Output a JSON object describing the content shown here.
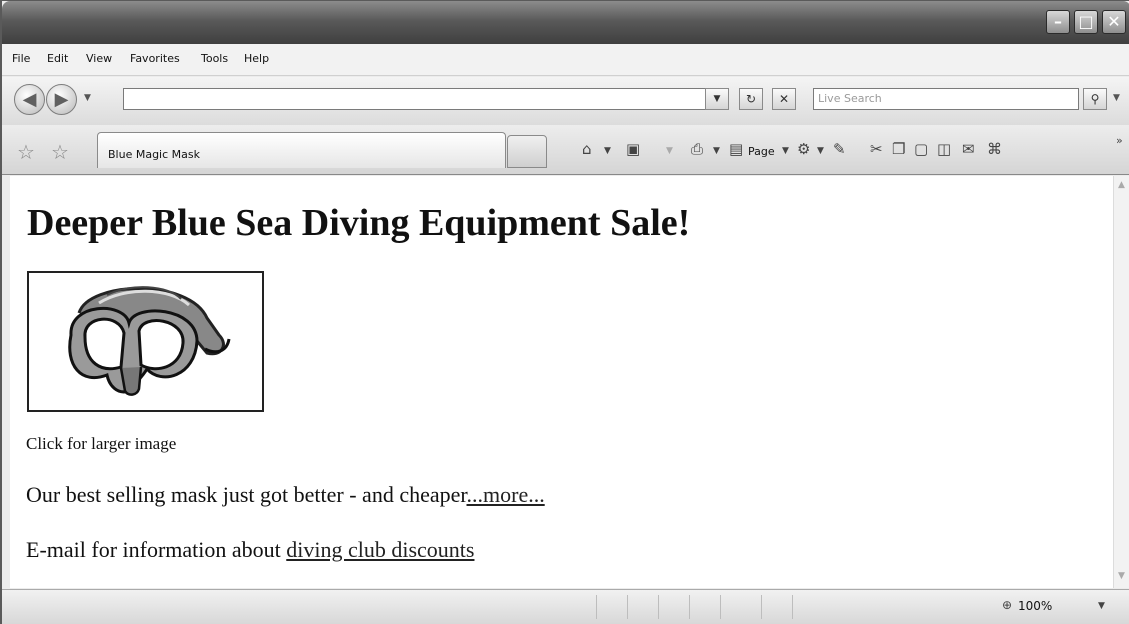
{
  "menu": [
    "File",
    "Edit",
    "View",
    "Favorites",
    "Tools",
    "Help"
  ],
  "address": {
    "value": "",
    "search_placeholder": "Live Search"
  },
  "tab": {
    "title": "Blue Magic Mask"
  },
  "toolbar": {
    "page_label": "Page"
  },
  "page": {
    "heading": "Deeper Blue Sea Diving Equipment Sale!",
    "image_caption": "Click for larger image",
    "line1_text": "Our best selling mask just got better - and cheaper",
    "line1_link": "...more...",
    "line2_text": "E-mail for information about ",
    "line2_link": "diving club discounts"
  },
  "status": {
    "zoom": "100%"
  },
  "icons": [
    "minimize-icon",
    "maximize-icon",
    "close-icon",
    "back-icon",
    "forward-icon",
    "refresh-icon",
    "stop-icon",
    "search-icon",
    "favorites-star-icon",
    "add-favorites-icon",
    "home-icon",
    "feeds-icon",
    "print-icon",
    "page-icon",
    "tools-icon",
    "research-icon",
    "cut-icon",
    "copy-icon",
    "paste-icon",
    "zoom-icon"
  ]
}
